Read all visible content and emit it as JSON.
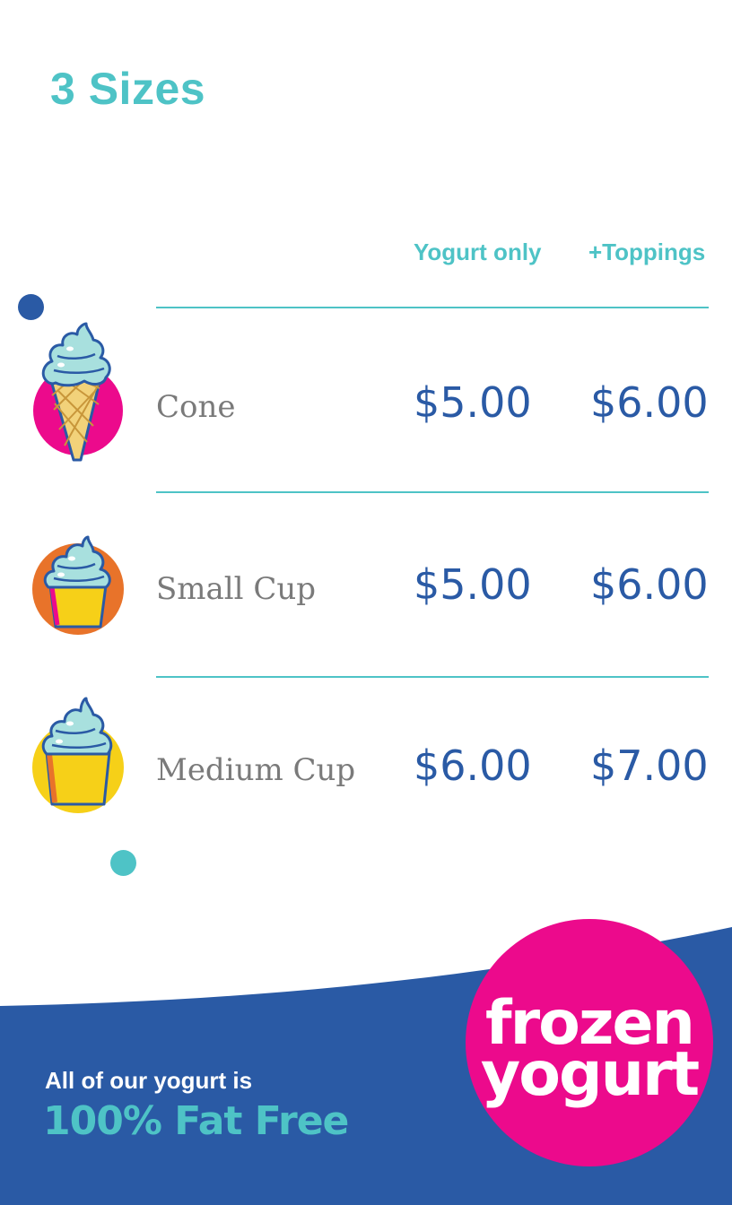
{
  "title": "3 Sizes",
  "columns": {
    "yogurt_only": "Yogurt only",
    "toppings": "+Toppings"
  },
  "items": [
    {
      "name": "Cone",
      "yogurt_only": "$5.00",
      "toppings": "$6.00",
      "icon": "ice-cream-cone-icon",
      "badge_color": "#ec0a8c"
    },
    {
      "name": "Small Cup",
      "yogurt_only": "$5.00",
      "toppings": "$6.00",
      "icon": "small-cup-icon",
      "badge_color": "#e8732a"
    },
    {
      "name": "Medium Cup",
      "yogurt_only": "$6.00",
      "toppings": "$7.00",
      "icon": "medium-cup-icon",
      "badge_color": "#f6d018"
    }
  ],
  "footer": {
    "line1": "All of our yogurt is",
    "line2": "100% Fat Free",
    "logo_line1": "frozen",
    "logo_line2": "yogurt"
  },
  "colors": {
    "teal": "#4ec3c6",
    "blue": "#2a5aa5",
    "pink": "#ec0a8c",
    "orange": "#e8732a",
    "yellow": "#f6d018",
    "gray": "#7a7a7a"
  }
}
